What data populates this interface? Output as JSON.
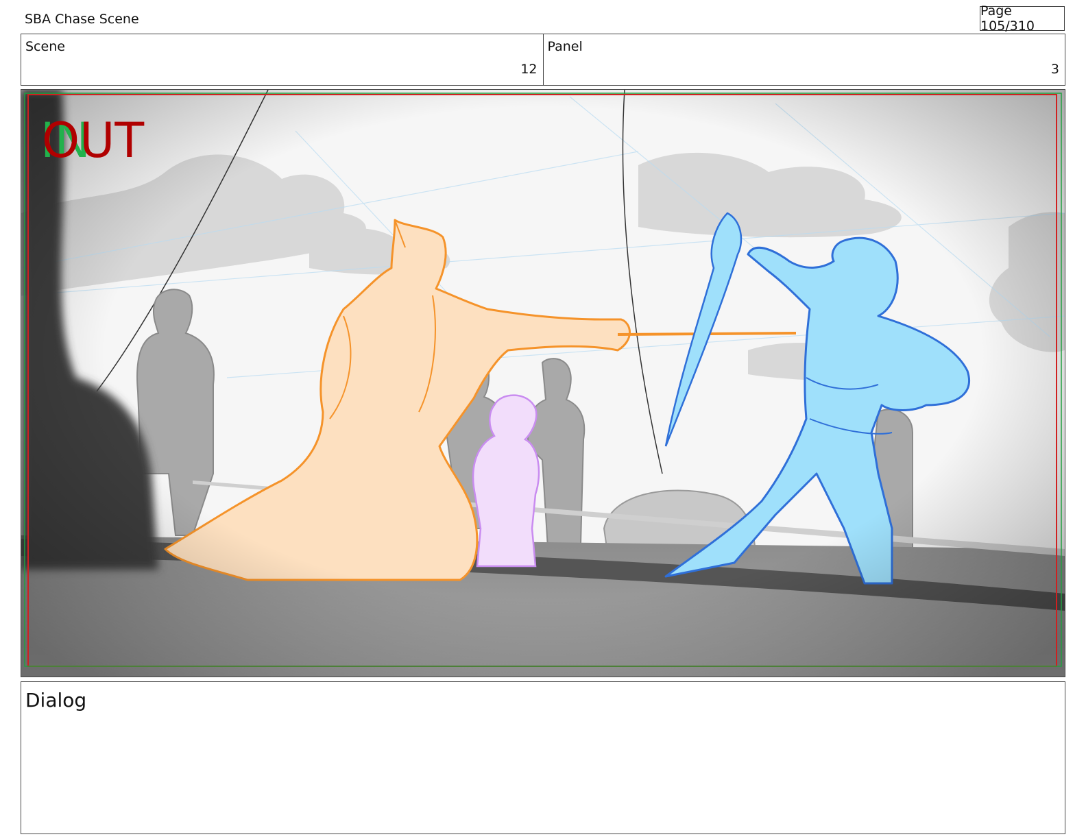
{
  "header": {
    "title": "SBA Chase Scene",
    "page": "Page 105/310"
  },
  "info": {
    "scene_label": "Scene",
    "scene_value": "12",
    "panel_label": "Panel",
    "panel_value": "3"
  },
  "panel": {
    "in_marker": "IN",
    "out_marker": "OUT",
    "colors": {
      "in_green": "#22b14c",
      "out_red": "#b00000",
      "safe_frame_red": "#d02020",
      "safe_frame_green": "#20a040",
      "character_orange": "#f5932a",
      "character_orange_fill": "#fde0c0",
      "character_blue": "#2f6fd8",
      "character_blue_fill": "#9fe0fb",
      "character_purple": "#c98cf0",
      "character_purple_fill": "#f2ddfb"
    }
  },
  "dialog": {
    "label": "Dialog"
  }
}
